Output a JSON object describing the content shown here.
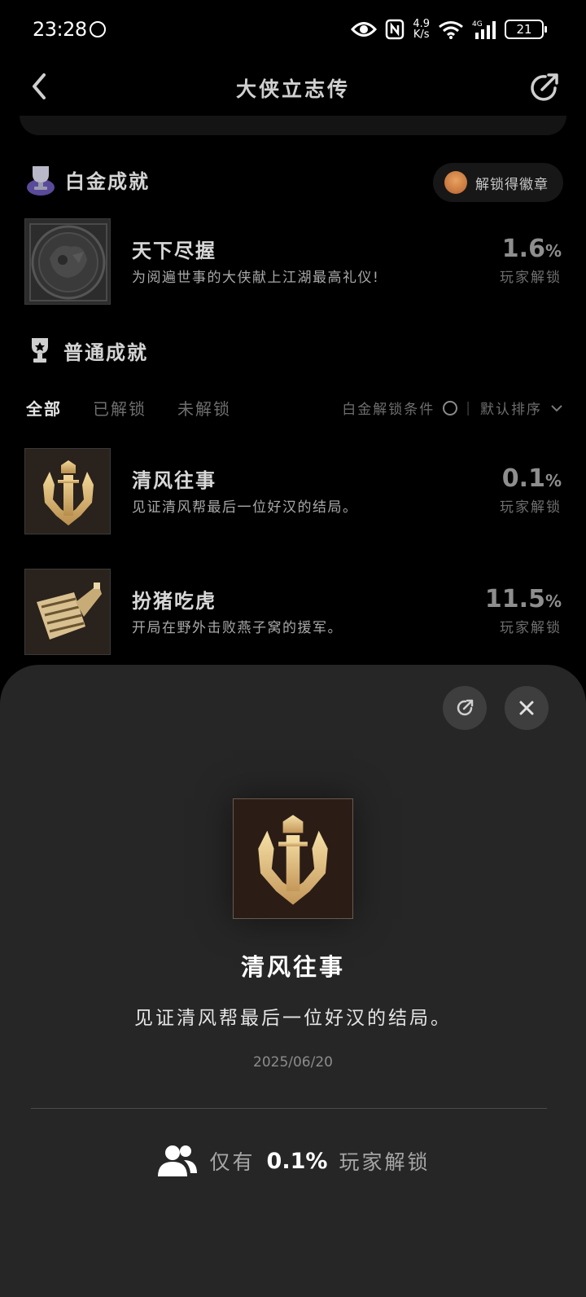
{
  "status_bar": {
    "time": "23:28",
    "net_speed_value": "4.9",
    "net_speed_unit": "K/s",
    "battery": "21"
  },
  "nav": {
    "title": "大侠立志传",
    "back_icon": "chevron-left-icon",
    "share_icon": "share-icon"
  },
  "platinum": {
    "section_title": "白金成就",
    "badge_label": "解锁得徽章",
    "item": {
      "name": "天下尽握",
      "desc": "为阅遍世事的大侠献上江湖最高礼仪!",
      "pct": "1.6",
      "pct_unit": "%",
      "pct_label": "玩家解锁"
    }
  },
  "normal": {
    "section_title": "普通成就",
    "tabs": [
      "全部",
      "已解锁",
      "未解锁"
    ],
    "filter_condition": "白金解锁条件",
    "sort_label": "默认排序",
    "items": [
      {
        "name": "清风往事",
        "desc": "见证清风帮最后一位好汉的结局。",
        "pct": "0.1",
        "pct_unit": "%",
        "pct_label": "玩家解锁"
      },
      {
        "name": "扮猪吃虎",
        "desc": "开局在野外击败燕子窝的援军。",
        "pct": "11.5",
        "pct_unit": "%",
        "pct_label": "玩家解锁"
      }
    ]
  },
  "sheet": {
    "name": "清风往事",
    "desc": "见证清风帮最后一位好汉的结局。",
    "date": "2025/06/20",
    "stat_pre": "仅有",
    "stat_value": "0.1%",
    "stat_post": "玩家解锁",
    "share_icon": "share-icon",
    "close_icon": "close-icon",
    "users_icon": "users-icon"
  },
  "colors": {
    "background": "#000000",
    "sheet": "#262626",
    "gold_icon": "#d9b77a"
  }
}
